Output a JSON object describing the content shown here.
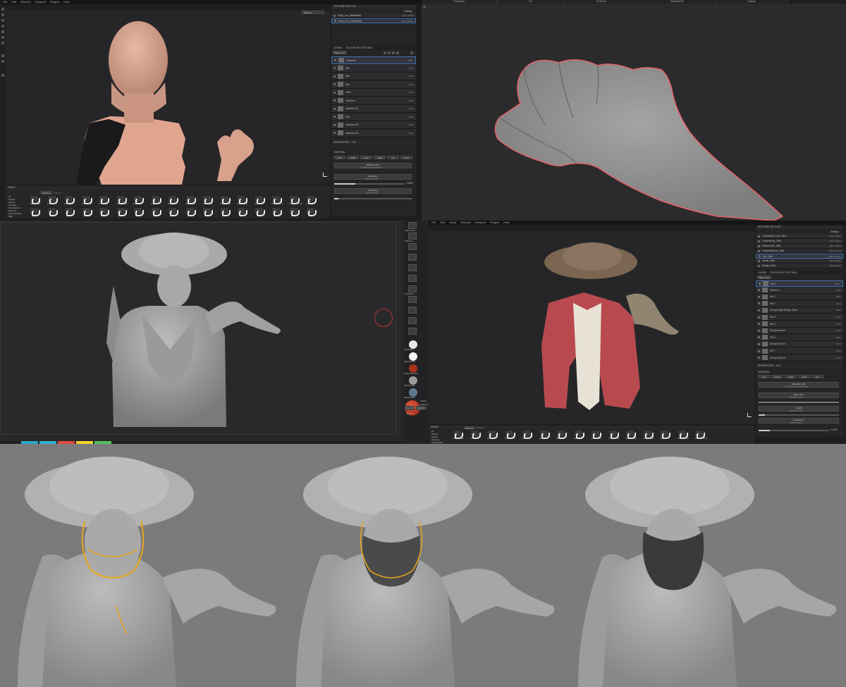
{
  "top_left": {
    "menu": [
      "File",
      "Edit",
      "Window",
      "Viewport",
      "Plugins",
      "Help"
    ],
    "viewport_dropdown": "Material",
    "texture_set_list": {
      "title": "TEXTURE SET LIST",
      "settings_label": "Settings",
      "items": [
        {
          "name": "Head_Low_defaultMat1",
          "shader": "Main shader"
        },
        {
          "name": "Hand_Low_defaultMat1",
          "shader": "Main shader"
        }
      ]
    },
    "layers": {
      "tabs": [
        "LAYERS",
        "TEXTURE SET SETTINGS"
      ],
      "base_color": "Base Color",
      "rows": [
        "Occlusion",
        "Skin",
        "Skin",
        "Skin",
        "Veins",
        "Variations",
        "Variations 01",
        "Skin",
        "Variations 02",
        "Variations 03"
      ],
      "blend": "Norm"
    },
    "properties": {
      "title": "PROPERTIES - FILL",
      "material_label": "MATERIAL",
      "channels": [
        "color",
        "height",
        "rough",
        "metal",
        "nrm",
        "emiss"
      ],
      "material_mode": "Material mode",
      "no_resource": "No Resource Selected",
      "base_color_label": "Basecolor",
      "base_color_sub": "uniform color",
      "sub_value": "0.2569",
      "scattering_label": "Scattering",
      "scattering_sub": "uniform color"
    },
    "shelf": {
      "title": "SHELF",
      "dropdown": "Brushes",
      "search_placeholder": "Search",
      "categories": [
        "All",
        "Project",
        "Alphas",
        "Grunges",
        "Procedurals",
        "Textures",
        "Hard Surfaces",
        "Skin",
        "Filters",
        "Brushes",
        "Particles",
        "Tools",
        "Materials",
        "Smart materials",
        "Smart masks",
        "Environments",
        "Color profiles"
      ],
      "brush_labels": [
        "Cartoon Tape",
        "Artistic Soft",
        "Artistic Cut",
        "Artistic Paint",
        "Artistic Soft",
        "Artistic Stroke",
        "Basic Hard",
        "Basic Soft",
        "Bristle",
        "Carbon Cuts",
        "Chalk Bumpy",
        "Chalk Spread",
        "Chalk Strong",
        "Charcoal",
        "Charcoal Fine",
        "Charcoal No Tex",
        "Cracks"
      ]
    }
  },
  "top_right": {
    "tabs": [
      "Properties",
      "UV",
      "UVW/UV",
      "ModularEdit",
      "Outline"
    ]
  },
  "mid_left": {
    "bottom_swatch_colors": [
      "#2aa7c9",
      "#35b0d1",
      "#e4483a",
      "#f5d22a",
      "#57c05c"
    ]
  },
  "mid_center": {
    "tools": [
      "SelectLasso",
      "ClipCurve",
      "",
      "",
      "",
      "",
      "Transpose",
      "",
      "",
      "",
      ""
    ],
    "materials": [
      {
        "name": "SkinShade4",
        "color": "#e6e6e6"
      },
      {
        "name": "BasicMaterial",
        "color": "#f2f2f2"
      },
      {
        "name": "MatCap Red Wax",
        "color": "#a6321f"
      },
      {
        "name": "MatCap Gray",
        "color": "#9a9a9a"
      },
      {
        "name": "BasicMaterial",
        "color": "#5f7a8f"
      }
    ],
    "color_labels": [
      "Gradient",
      "SwitchColor",
      "Alternate"
    ],
    "bottom_buttons": [
      "Clear Rt",
      "Clear Fr"
    ],
    "label_clear": "Clear To"
  },
  "mid_right": {
    "menu": [
      "File",
      "Edit",
      "Mode",
      "Window",
      "Viewport",
      "Plugins",
      "Help"
    ],
    "texture_set_list": {
      "title": "TEXTURE SET LIST",
      "settings_label": "Settings",
      "items": [
        {
          "name": "ClothesBoot_Low_1Mat",
          "shader": "Main shader"
        },
        {
          "name": "ClothesBody_1Mat",
          "shader": "Main shader"
        },
        {
          "name": "ClothesShirt_1Mat",
          "shader": "Main shader"
        },
        {
          "name": "ClothesSleeves_1Mat",
          "shader": "Main shader"
        },
        {
          "name": "Hat_1Mat",
          "shader": "Main shader"
        },
        {
          "name": "Jacket_1Mat",
          "shader": "Main shader"
        },
        {
          "name": "Strings_1Mat",
          "shader": "Main shader"
        }
      ]
    },
    "layers": {
      "tabs": [
        "LAYERS",
        "TEXTURE SET SETTINGS"
      ],
      "base_color": "Base Color",
      "rows": [
        "Dirt 1",
        "Wnkson 1",
        "Dirt 2",
        "Dirt 3",
        "Grunge Edge Bumpy Glass",
        "Dirt 4",
        "Dirt 5",
        "Grunge Scratch",
        "Dirt 6",
        "Grunge Map 01",
        "Dirt 7",
        "Grunge Map 02"
      ],
      "blend": "Norm"
    },
    "properties": {
      "title": "PROPERTIES - FILL",
      "material_label": "MATERIAL",
      "channels": [
        "color",
        "height",
        "rough",
        "metal",
        "nrm"
      ],
      "material_mode": "Material mode",
      "no_resource": "No Resource Selected",
      "base_color_label": "Base color",
      "base_color_sub": "uniform color",
      "height_label": "Height",
      "height_sub": "uniform color",
      "roughness_label": "Roughness",
      "roughness_sub": "uniform color",
      "value": "0.1600"
    },
    "shelf": {
      "title": "SHELF",
      "dropdown": "Brushes",
      "search_placeholder": "Search",
      "categories": [
        "All",
        "Project",
        "Alphas",
        "Grunges",
        "Procedurals",
        "Textures",
        "Hard Surfaces"
      ],
      "brush_labels": [
        "Cartoon Tape",
        "Artistic Soft",
        "Artistic Cut",
        "Artistic Paint",
        "Artistic Soft",
        "Basic Hard",
        "Basic Soft",
        "Bristle",
        "Carbon Cuts",
        "Chalk Bumpy",
        "Chalk Spread",
        "Chalk Strong",
        "Charcoal",
        "Charcoal Fine",
        "Charcoal No Tex"
      ]
    }
  },
  "colors": {
    "selection_blue": "#3f6fb0",
    "hair_guide": "#e8a51a",
    "hand_outline": "#e8626a"
  }
}
